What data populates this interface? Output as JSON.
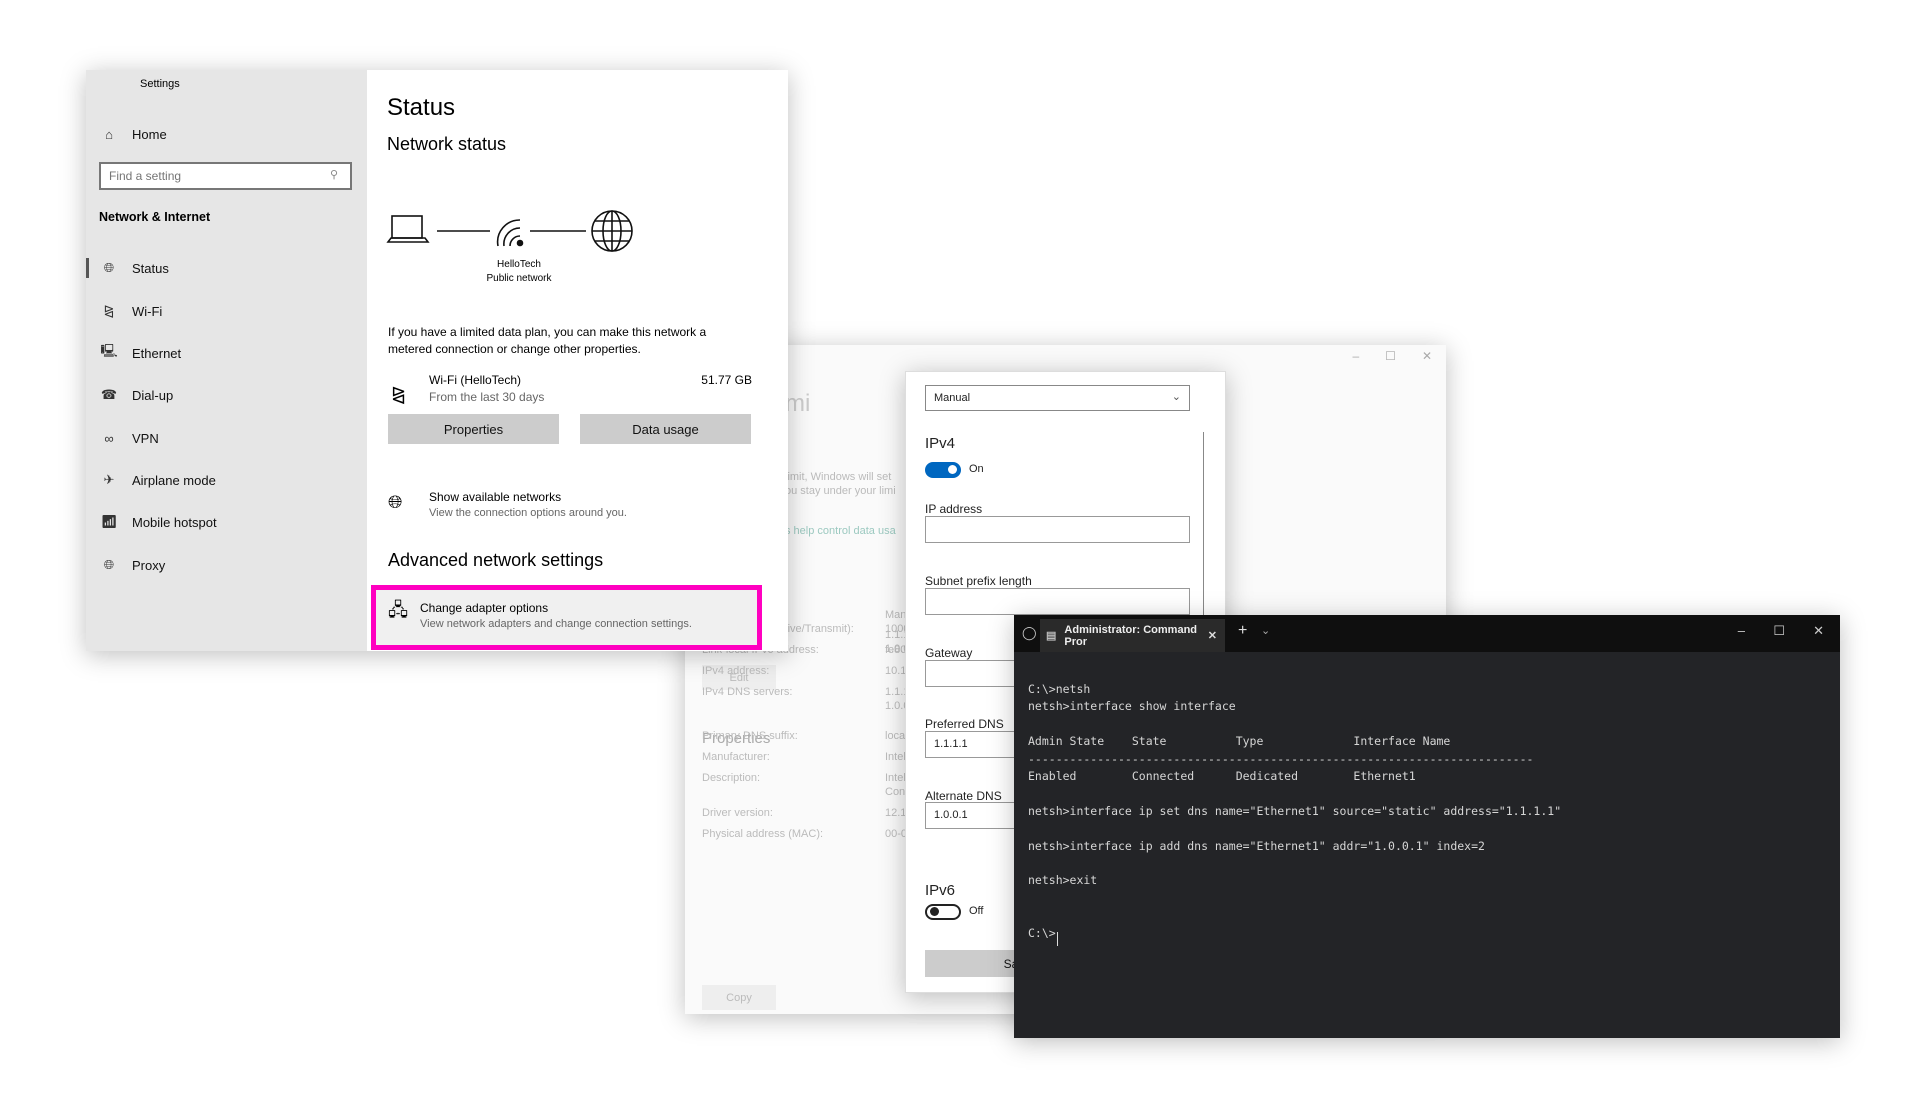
{
  "settings": {
    "title": "Settings",
    "home": "Home",
    "search_placeholder": "Find a setting",
    "section": "Network & Internet",
    "nav": [
      {
        "label": "Status",
        "icon": "globe-icon"
      },
      {
        "label": "Wi-Fi",
        "icon": "wifi-icon"
      },
      {
        "label": "Ethernet",
        "icon": "ethernet-icon"
      },
      {
        "label": "Dial-up",
        "icon": "dialup-icon"
      },
      {
        "label": "VPN",
        "icon": "vpn-icon"
      },
      {
        "label": "Airplane mode",
        "icon": "airplane-icon"
      },
      {
        "label": "Mobile hotspot",
        "icon": "hotspot-icon"
      },
      {
        "label": "Proxy",
        "icon": "globe-icon"
      }
    ],
    "page_title": "Status",
    "network_status": "Network status",
    "network_name": "HelloTech",
    "network_type": "Public network",
    "metered_text_1": "If you have a limited data plan, you can make this network a",
    "metered_text_2": "metered connection or change other properties.",
    "wifi_name": "Wi-Fi (HelloTech)",
    "wifi_period": "From the last 30 days",
    "wifi_usage": "51.77 GB",
    "properties_btn": "Properties",
    "data_usage_btn": "Data usage",
    "show_networks": "Show available networks",
    "show_networks_sub": "View the connection options around you.",
    "advanced": "Advanced network settings",
    "adapter": "Change adapter options",
    "adapter_sub": "View network adapters and change connection settings.",
    "highlight_color": "#ff00c0"
  },
  "background": {
    "title_frag": "mi",
    "limit_1": "limit, Windows will set",
    "limit_2": "ou stay under your limi",
    "link": "s help control data usa",
    "manual": "Manu",
    "dns1": "1.1.1.",
    "dns2": "1.0.0.",
    "edit": "Edit",
    "properties": "Properties",
    "props": [
      {
        "k": "Link speed (Receive/Transmit):",
        "v": "1000/"
      },
      {
        "k": "Link-local IPv6 address:",
        "v": "fe80:"
      },
      {
        "k": "IPv4 address:",
        "v": "10.1.4"
      },
      {
        "k": "IPv4 DNS servers:",
        "v": "1.1.1."
      },
      {
        "k": "",
        "v": "1.0.0."
      },
      {
        "k": "Primary DNS suffix:",
        "v": "local"
      },
      {
        "k": "Manufacturer:",
        "v": "Intel"
      },
      {
        "k": "Description:",
        "v": "Intel"
      },
      {
        "k": "",
        "v": "Conn"
      },
      {
        "k": "Driver version:",
        "v": "12.17"
      },
      {
        "k": "Physical address (MAC):",
        "v": "00-0"
      }
    ],
    "copy": "Copy"
  },
  "dialog": {
    "mode": "Manual",
    "ipv4": "IPv4",
    "ipv4_state": "On",
    "ip_label": "IP address",
    "ip_value": "",
    "subnet_label": "Subnet prefix length",
    "subnet_value": "",
    "gateway_label": "Gateway",
    "gateway_value": "",
    "pdns_label": "Preferred DNS",
    "pdns_value": "1.1.1.1",
    "adns_label": "Alternate DNS",
    "adns_value": "1.0.0.1",
    "ipv6": "IPv6",
    "ipv6_state": "Off",
    "save": "Save",
    "accent": "#0067c0"
  },
  "cmd": {
    "tab_title": "Administrator: Command Pror",
    "lines": [
      "C:\\>netsh",
      "netsh>interface show interface",
      "",
      "Admin State    State          Type             Interface Name",
      "-------------------------------------------------------------------------",
      "Enabled        Connected      Dedicated        Ethernet1",
      "",
      "netsh>interface ip set dns name=\"Ethernet1\" source=\"static\" address=\"1.1.1.1\"",
      "",
      "netsh>interface ip add dns name=\"Ethernet1\" addr=\"1.0.0.1\" index=2",
      "",
      "netsh>exit",
      "",
      "",
      "C:\\>"
    ]
  }
}
